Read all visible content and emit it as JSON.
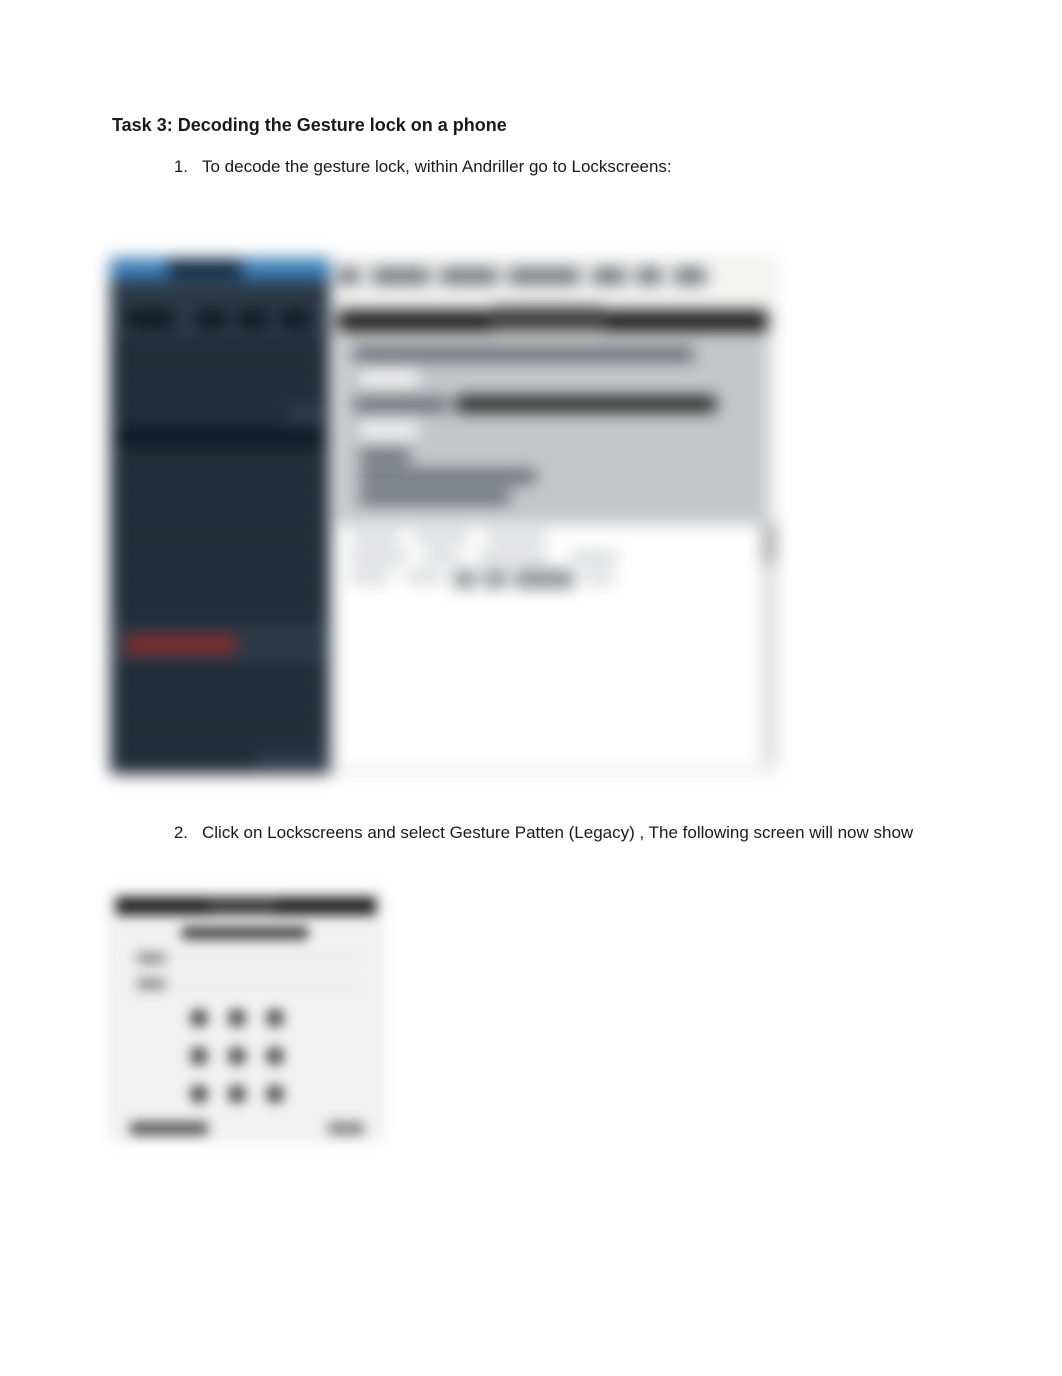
{
  "task": {
    "heading": "Task 3:  Decoding the Gesture lock on a phone",
    "steps": [
      "To decode the gesture lock, within Andriller go to Lockscreens:",
      "Click on Lockscreens and select Gesture Patten (Legacy) , The following screen will now show"
    ],
    "step_numbers": [
      "1.",
      "2."
    ]
  },
  "figure1": {
    "description": "Blurred screenshot of Andriller application window showing a dark left sidebar and a light right panel with menu bar and Lockscreens area."
  },
  "figure2": {
    "description": "Blurred screenshot of Gesture Pattern dialog showing a 3x3 grid of pattern dots with Open and Start controls."
  }
}
